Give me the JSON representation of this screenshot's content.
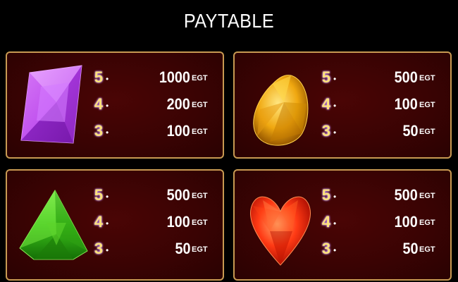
{
  "title": "PAYTABLE",
  "currency": "EGT",
  "panels": [
    {
      "symbol": "purple-diamond",
      "color": "#c25bff",
      "rows": [
        {
          "count": "5",
          "value": "1000"
        },
        {
          "count": "4",
          "value": "200"
        },
        {
          "count": "3",
          "value": "100"
        }
      ]
    },
    {
      "symbol": "yellow-egg-gem",
      "color": "#f2b312",
      "rows": [
        {
          "count": "5",
          "value": "500"
        },
        {
          "count": "4",
          "value": "100"
        },
        {
          "count": "3",
          "value": "50"
        }
      ]
    },
    {
      "symbol": "green-triangle-gem",
      "color": "#3ec41c",
      "rows": [
        {
          "count": "5",
          "value": "500"
        },
        {
          "count": "4",
          "value": "100"
        },
        {
          "count": "3",
          "value": "50"
        }
      ]
    },
    {
      "symbol": "red-heart-gem",
      "color": "#ff3a1a",
      "rows": [
        {
          "count": "5",
          "value": "500"
        },
        {
          "count": "4",
          "value": "100"
        },
        {
          "count": "3",
          "value": "50"
        }
      ]
    }
  ]
}
